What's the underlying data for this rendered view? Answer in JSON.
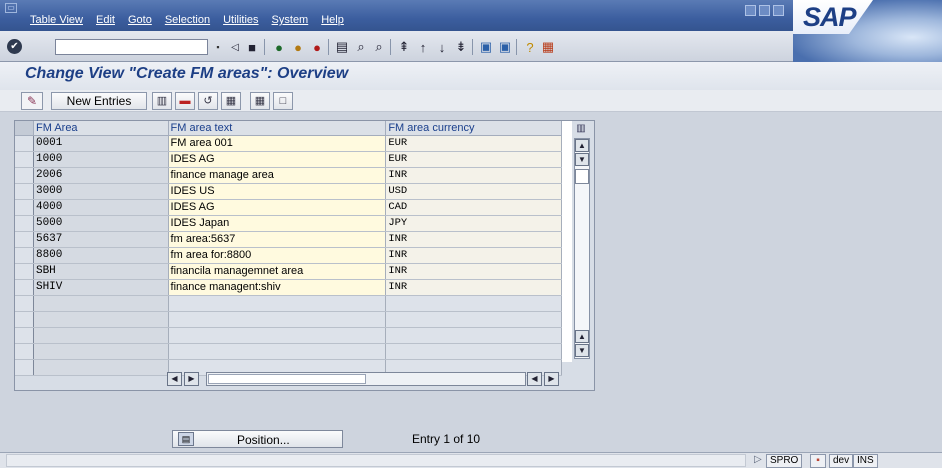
{
  "menubar": {
    "items": [
      "Table View",
      "Edit",
      "Goto",
      "Selection",
      "Utilities",
      "System",
      "Help"
    ]
  },
  "logo": {
    "text": "SAP"
  },
  "stdbar": {
    "command_value": "",
    "icons": [
      "enter-icon",
      "save-icon",
      "back-icon",
      "exit-icon",
      "cancel-icon",
      "print-icon",
      "find-icon",
      "find-next-icon",
      "first-page-icon",
      "previous-page-icon",
      "next-page-icon",
      "last-page-icon",
      "create-session-icon",
      "shortcut-icon",
      "help-icon",
      "layout-icon"
    ]
  },
  "title": "Change View \"Create FM areas\": Overview",
  "app_toolbar": {
    "new_entries_label": "New Entries"
  },
  "table": {
    "columns": [
      "FM Area",
      "FM area text",
      "FM area currency"
    ],
    "rows": [
      {
        "area": "0001",
        "text": "FM area 001",
        "currency": "EUR"
      },
      {
        "area": "1000",
        "text": "IDES AG",
        "currency": "EUR"
      },
      {
        "area": "2006",
        "text": "finance manage area",
        "currency": "INR"
      },
      {
        "area": "3000",
        "text": "IDES US",
        "currency": "USD"
      },
      {
        "area": "4000",
        "text": "IDES AG",
        "currency": "CAD"
      },
      {
        "area": "5000",
        "text": "IDES Japan",
        "currency": "JPY"
      },
      {
        "area": "5637",
        "text": "fm area:5637",
        "currency": "INR"
      },
      {
        "area": "8800",
        "text": "fm area for:8800",
        "currency": "INR"
      },
      {
        "area": "SBH",
        "text": "financila managemnet area",
        "currency": "INR"
      },
      {
        "area": "SHIV",
        "text": "finance managent:shiv",
        "currency": "INR"
      }
    ],
    "empty_rows": 5
  },
  "position_button": {
    "label": "Position..."
  },
  "entry_info": "Entry 1 of 10",
  "statusbar": {
    "transaction": "SPRO",
    "system": "dev",
    "mode": "INS"
  }
}
